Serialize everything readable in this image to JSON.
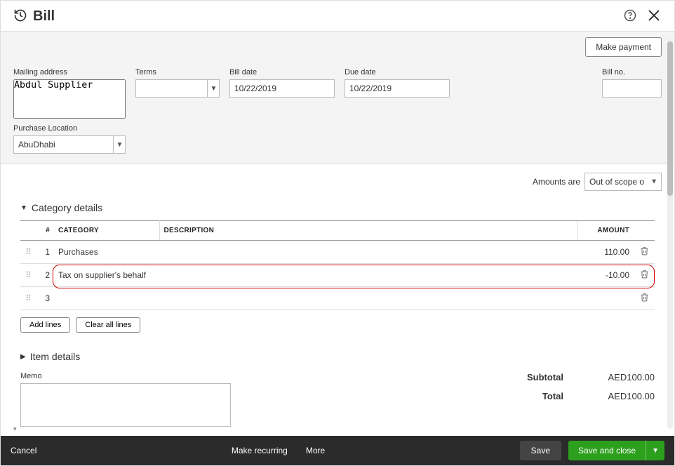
{
  "header": {
    "title": "Bill",
    "make_payment": "Make payment"
  },
  "fields": {
    "mailing_label": "Mailing address",
    "mailing_value": "Abdul Supplier",
    "terms_label": "Terms",
    "terms_value": "",
    "bill_date_label": "Bill date",
    "bill_date_value": "10/22/2019",
    "due_date_label": "Due date",
    "due_date_value": "10/22/2019",
    "bill_no_label": "Bill no.",
    "bill_no_value": "",
    "location_label": "Purchase Location",
    "location_value": "AbuDhabi"
  },
  "amounts": {
    "label": "Amounts are",
    "value": "Out of scope of Tax"
  },
  "category_section": {
    "title": "Category details",
    "cols": {
      "num": "#",
      "category": "CATEGORY",
      "description": "DESCRIPTION",
      "amount": "AMOUNT"
    },
    "rows": [
      {
        "num": "1",
        "category": "Purchases",
        "description": "",
        "amount": "110.00"
      },
      {
        "num": "2",
        "category": "Tax on supplier's behalf",
        "description": "",
        "amount": "-10.00"
      },
      {
        "num": "3",
        "category": "",
        "description": "",
        "amount": ""
      }
    ],
    "add_lines": "Add lines",
    "clear_lines": "Clear all lines"
  },
  "item_section": {
    "title": "Item details"
  },
  "memo": {
    "label": "Memo",
    "value": ""
  },
  "totals": {
    "subtotal_label": "Subtotal",
    "subtotal_value": "AED100.00",
    "total_label": "Total",
    "total_value": "AED100.00"
  },
  "footer": {
    "cancel": "Cancel",
    "make_recurring": "Make recurring",
    "more": "More",
    "save": "Save",
    "save_close": "Save and close"
  }
}
